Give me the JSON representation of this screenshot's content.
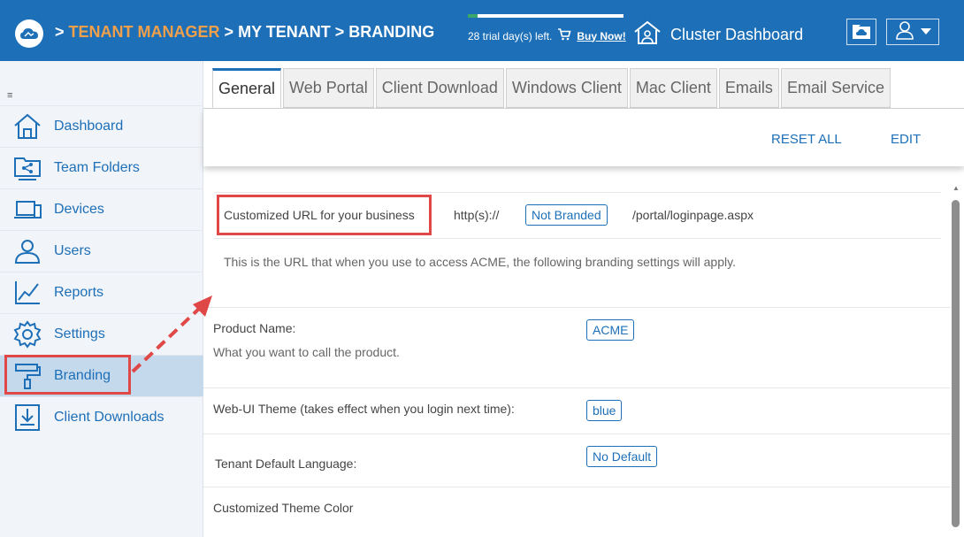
{
  "header": {
    "breadcrumb_prefix1": ">",
    "tenant_manager": "TENANT MANAGER",
    "breadcrumb_sep1": ">",
    "my_tenant": "MY TENANT",
    "breadcrumb_sep2": ">",
    "branding": "BRANDING",
    "trial_text": "28 trial day(s) left.",
    "trial_progress_fraction": 0.06,
    "buy_now": "Buy Now!",
    "cluster_dashboard": "Cluster Dashboard",
    "brand_color": "#1d6fb8",
    "accent_color": "#f0a04b"
  },
  "sidebar": {
    "collapse_icon": "≡",
    "items": [
      {
        "label": "Dashboard",
        "icon": "home-icon"
      },
      {
        "label": "Team Folders",
        "icon": "share-folder-icon"
      },
      {
        "label": "Devices",
        "icon": "devices-icon"
      },
      {
        "label": "Users",
        "icon": "users-icon"
      },
      {
        "label": "Reports",
        "icon": "chart-icon"
      },
      {
        "label": "Settings",
        "icon": "gear-icon"
      },
      {
        "label": "Branding",
        "icon": "paint-roller-icon"
      },
      {
        "label": "Client Downloads",
        "icon": "download-icon"
      }
    ]
  },
  "tabs": [
    "General",
    "Web Portal",
    "Client Download",
    "Windows Client",
    "Mac Client",
    "Emails",
    "Email Service"
  ],
  "toolbar": {
    "reset_all": "RESET ALL",
    "edit": "EDIT"
  },
  "content": {
    "custom_url_label": "Customized URL for your business",
    "url_prefix": "http(s)://",
    "url_value": "Not Branded",
    "url_suffix": "/portal/loginpage.aspx",
    "url_description": "This is the URL that when you use to access ACME, the following branding settings will apply.",
    "product_name_label": "Product Name:",
    "product_name_desc": "What you want to call the product.",
    "product_name_value": "ACME",
    "theme_label": "Web-UI Theme (takes effect when you login next time):",
    "theme_value": "blue",
    "language_label": "Tenant Default Language:",
    "language_value": "No Default",
    "theme_color_label": "Customized Theme Color"
  }
}
